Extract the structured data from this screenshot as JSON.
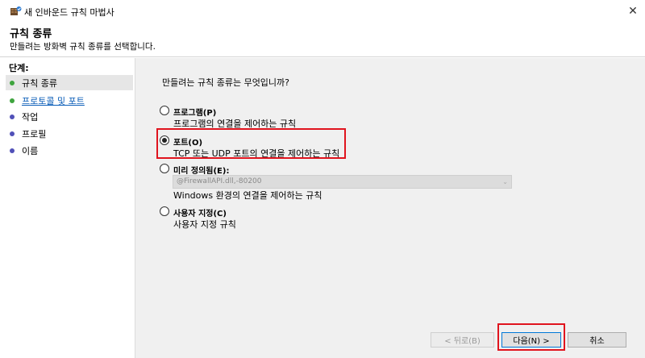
{
  "window": {
    "title": "새 인바운드 규칙 마법사"
  },
  "header": {
    "title": "규칙 종류",
    "description": "만들려는 방화벽 규칙 종류를 선택합니다."
  },
  "sidebar": {
    "steps_label": "단계:",
    "steps": [
      {
        "label": "규칙 종류",
        "state": "complete"
      },
      {
        "label": "프로토콜 및 포트",
        "state": "link"
      },
      {
        "label": "작업",
        "state": "pending"
      },
      {
        "label": "프로필",
        "state": "pending"
      },
      {
        "label": "이름",
        "state": "pending"
      }
    ]
  },
  "main": {
    "question": "만들려는 규칙 종류는 무엇입니까?",
    "options": [
      {
        "label": "프로그램(P)",
        "description": "프로그램의 연결을 제어하는 규칙",
        "checked": false
      },
      {
        "label": "포트(O)",
        "description": "TCP 또는 UDP 포트의 연결을 제어하는 규칙",
        "checked": true
      },
      {
        "label": "미리 정의됨(E):",
        "description": "Windows 환경의 연결을 제어하는 규칙",
        "checked": false,
        "select_value": "@FirewallAPI.dll,-80200"
      },
      {
        "label": "사용자 지정(C)",
        "description": "사용자 지정 규칙",
        "checked": false
      }
    ]
  },
  "buttons": {
    "back": "< 뒤로(B)",
    "next": "다음(N) >",
    "cancel": "취소"
  },
  "colors": {
    "step_complete": "#3ea43e",
    "step_pending": "#5050b8",
    "highlight": "#e0141e"
  }
}
